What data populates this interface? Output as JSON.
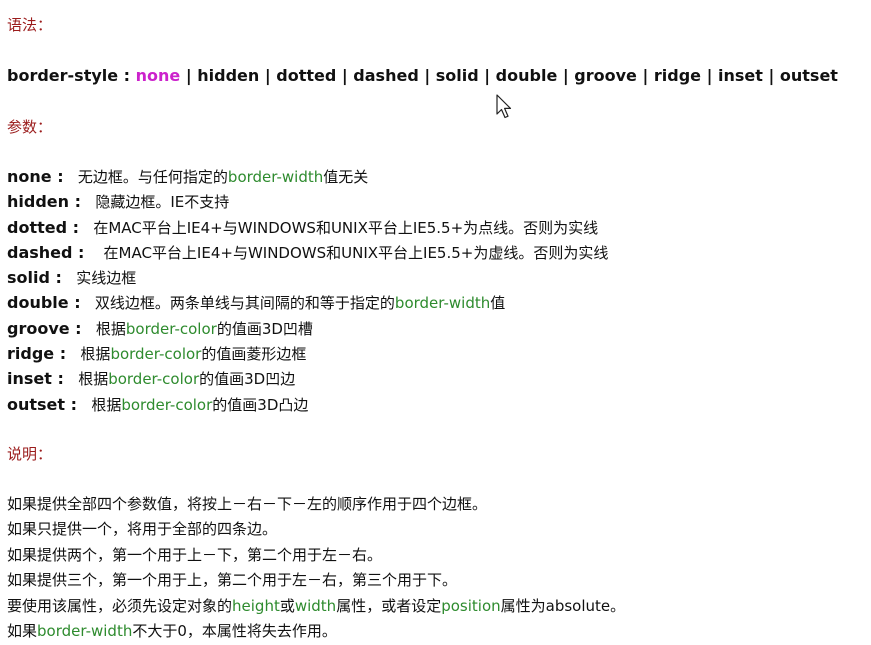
{
  "sections": {
    "syntax_title": "语法：",
    "params_title": "参数：",
    "notes_title": "说明："
  },
  "syntax": {
    "prefix": "border-style : ",
    "highlight": "none",
    "rest": " | hidden | dotted | dashed | solid | double | groove | ridge | inset | outset"
  },
  "params": [
    {
      "name": "none :",
      "pad": "   ",
      "segments": [
        {
          "text": "无边框。与任何指定的",
          "green": false
        },
        {
          "text": "border-width",
          "green": true
        },
        {
          "text": "值无关",
          "green": false
        }
      ]
    },
    {
      "name": "hidden :",
      "pad": "   ",
      "segments": [
        {
          "text": "隐藏边框。IE不支持",
          "green": false
        }
      ]
    },
    {
      "name": "dotted :",
      "pad": "   ",
      "segments": [
        {
          "text": "在MAC平台上IE4+与WINDOWS和UNIX平台上IE5.5+为点线。否则为实线",
          "green": false
        }
      ]
    },
    {
      "name": "dashed :",
      "pad": "    ",
      "segments": [
        {
          "text": "在MAC平台上IE4+与WINDOWS和UNIX平台上IE5.5+为虚线。否则为实线",
          "green": false
        }
      ]
    },
    {
      "name": "solid :",
      "pad": "   ",
      "segments": [
        {
          "text": "实线边框",
          "green": false
        }
      ]
    },
    {
      "name": "double :",
      "pad": "   ",
      "segments": [
        {
          "text": "双线边框。两条单线与其间隔的和等于指定的",
          "green": false
        },
        {
          "text": "border-width",
          "green": true
        },
        {
          "text": "值",
          "green": false
        }
      ]
    },
    {
      "name": "groove :",
      "pad": "   ",
      "segments": [
        {
          "text": "根据",
          "green": false
        },
        {
          "text": "border-color",
          "green": true
        },
        {
          "text": "的值画3D凹槽",
          "green": false
        }
      ]
    },
    {
      "name": "ridge :",
      "pad": "   ",
      "segments": [
        {
          "text": "根据",
          "green": false
        },
        {
          "text": "border-color",
          "green": true
        },
        {
          "text": "的值画菱形边框",
          "green": false
        }
      ]
    },
    {
      "name": "inset :",
      "pad": "   ",
      "segments": [
        {
          "text": "根据",
          "green": false
        },
        {
          "text": "border-color",
          "green": true
        },
        {
          "text": "的值画3D凹边",
          "green": false
        }
      ]
    },
    {
      "name": "outset :",
      "pad": "   ",
      "segments": [
        {
          "text": "根据",
          "green": false
        },
        {
          "text": "border-color",
          "green": true
        },
        {
          "text": "的值画3D凸边",
          "green": false
        }
      ]
    }
  ],
  "notes": [
    [
      {
        "text": "如果提供全部四个参数值，将按上－右－下－左的顺序作用于四个边框。",
        "green": false
      }
    ],
    [
      {
        "text": "如果只提供一个，将用于全部的四条边。",
        "green": false
      }
    ],
    [
      {
        "text": "如果提供两个，第一个用于上－下，第二个用于左－右。",
        "green": false
      }
    ],
    [
      {
        "text": "如果提供三个，第一个用于上，第二个用于左－右，第三个用于下。",
        "green": false
      }
    ],
    [
      {
        "text": "要使用该属性，必须先设定对象的",
        "green": false
      },
      {
        "text": "height",
        "green": true
      },
      {
        "text": "或",
        "green": false
      },
      {
        "text": "width",
        "green": true
      },
      {
        "text": "属性，或者设定",
        "green": false
      },
      {
        "text": "position",
        "green": true
      },
      {
        "text": "属性为absolute。",
        "green": false
      }
    ],
    [
      {
        "text": "如果",
        "green": false
      },
      {
        "text": "border-width",
        "green": true
      },
      {
        "text": "不大于0，本属性将失去作用。",
        "green": false
      }
    ]
  ]
}
